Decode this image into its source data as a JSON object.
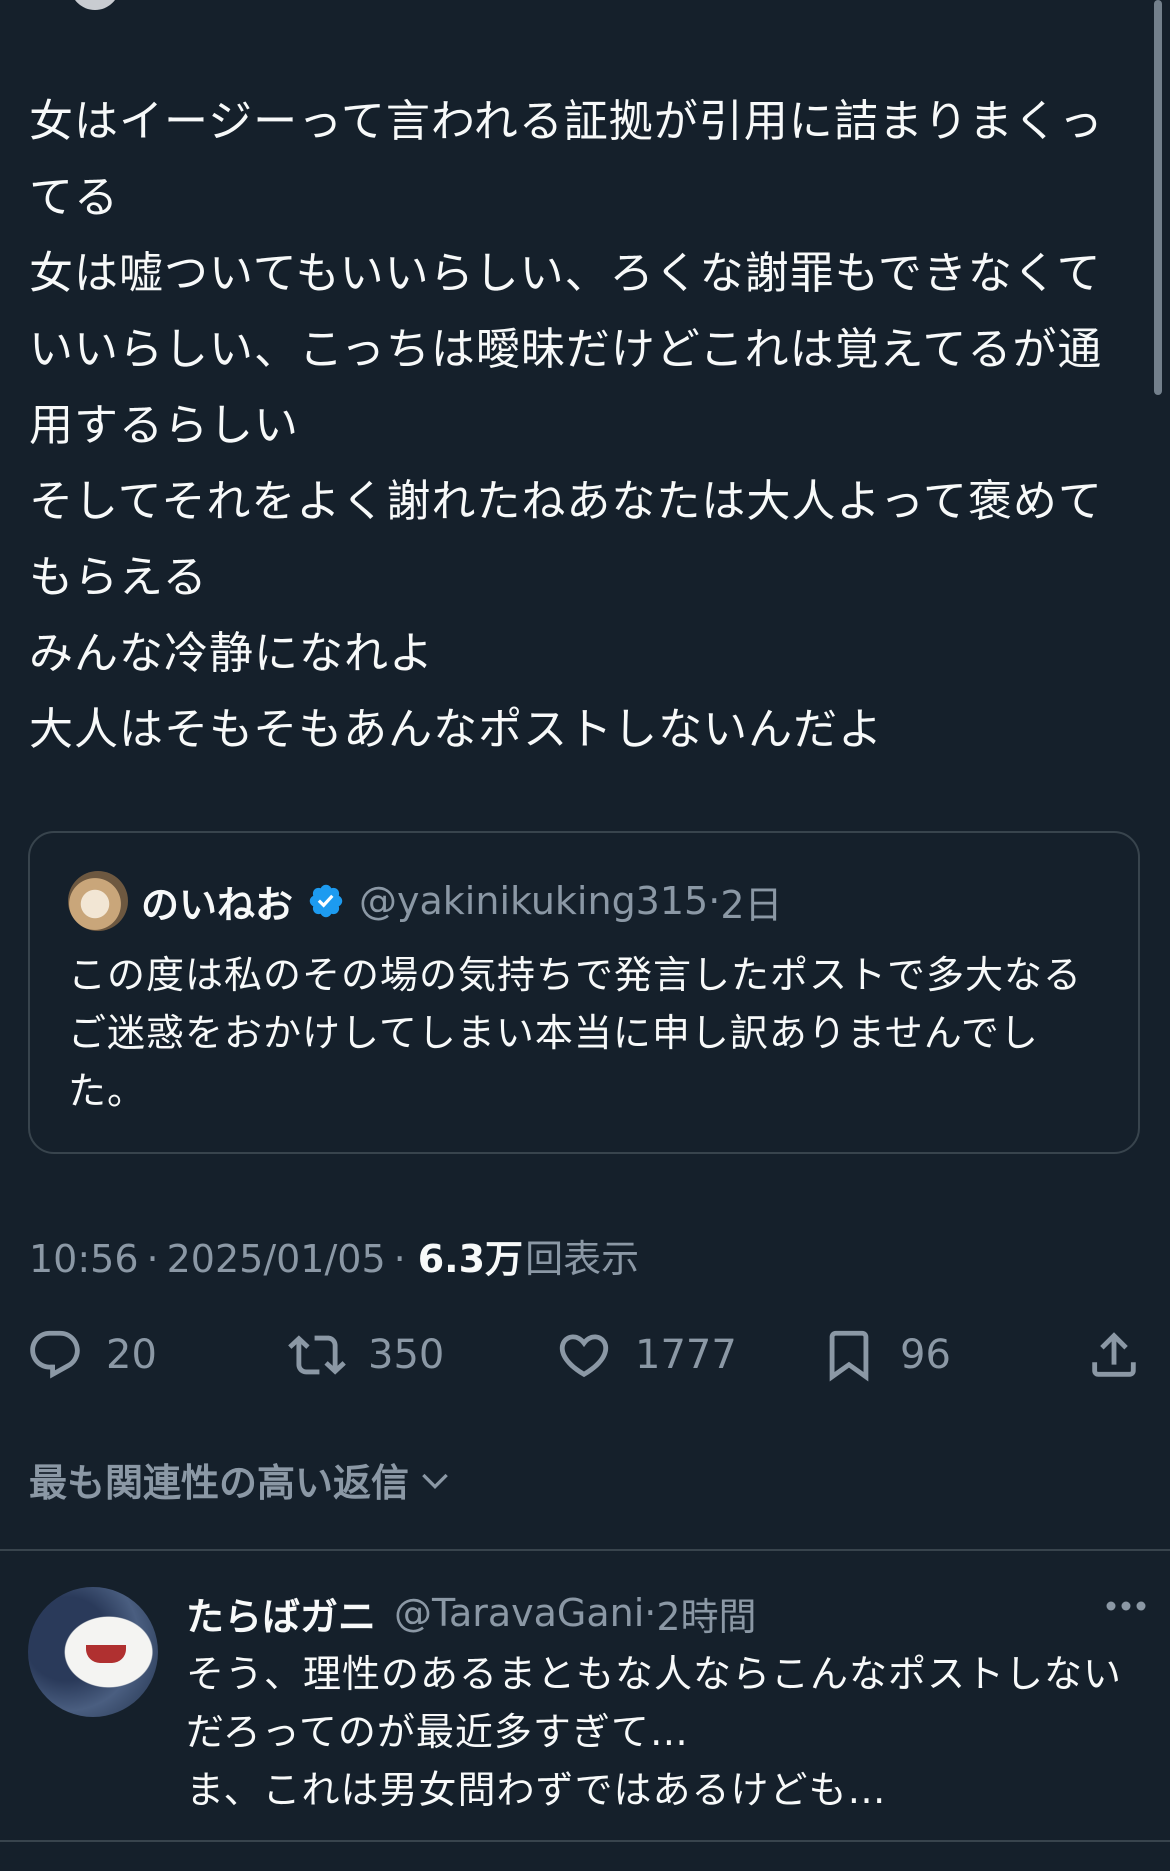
{
  "post": {
    "text": "女はイージーって言われる証拠が引用に詰まりまくってる\n女は嘘ついてもいいらしい、ろくな謝罪もできなくていいらしい、こっちは曖昧だけどこれは覚えてるが通用するらしい\nそしてそれをよく謝れたねあなたは大人よって褒めてもらえる\nみんな冷静になれよ\n大人はそもそもあんなポストしないんだよ",
    "quote": {
      "name": "のいねお",
      "handle": "@yakinikuking315",
      "separator": "·",
      "time": "2日",
      "text": "この度は私のその場の気持ちで発言したポストで多大なるご迷惑をおかけしてしまい本当に申し訳ありませんでした。"
    },
    "meta": {
      "time": "10:56",
      "separator": "·",
      "date": "2025/01/05",
      "separator2": "·",
      "views_count": "6.3万",
      "views_label": "回表示"
    },
    "actions": {
      "replies": "20",
      "reposts": "350",
      "likes": "1777",
      "bookmarks": "96"
    }
  },
  "replies_sort": {
    "label": "最も関連性の高い返信"
  },
  "reply": {
    "name": "たらばガニ",
    "handle": "@TaravaGani",
    "separator": "·",
    "time": "2時間",
    "text": "そう、理性のあるまともな人ならこんなポストしないだろってのが最近多すぎて…\nま、これは男女問わずではあるけども…"
  },
  "colors": {
    "background": "#15202b",
    "text": "#f7f9f9",
    "secondary": "#8b98a5",
    "border": "#38444d",
    "verified": "#1d9bf0"
  }
}
